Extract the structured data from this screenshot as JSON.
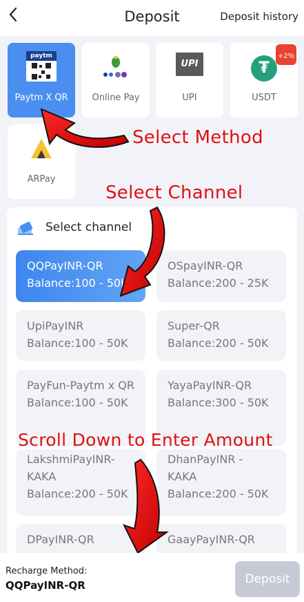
{
  "header": {
    "back_icon": "chevron-left-icon",
    "title": "Deposit",
    "history_link": "Deposit history"
  },
  "methods": [
    {
      "label": "Paytm X QR",
      "logo_text": "paytm",
      "active": true
    },
    {
      "label": "Online Pay",
      "active": false
    },
    {
      "label": "UPI",
      "logo_text": "UPI",
      "active": false
    },
    {
      "label": "USDT",
      "badge": "+2%",
      "active": false
    },
    {
      "label": "ARPay",
      "active": false
    }
  ],
  "channel_section": {
    "title": "Select channel"
  },
  "channels": [
    {
      "name": "QQPayINR-QR",
      "balance": "Balance:100 - 50K",
      "active": true
    },
    {
      "name": "OSpayINR-QR",
      "balance": "Balance:200 - 25K",
      "active": false
    },
    {
      "name": "UpiPayINR",
      "balance": "Balance:100 - 50K",
      "active": false
    },
    {
      "name": "Super-QR",
      "balance": "Balance:200 - 50K",
      "active": false
    },
    {
      "name": "PayFun-Paytm x QR",
      "balance": "Balance:100 - 50K",
      "active": false
    },
    {
      "name": "YayaPayINR-QR",
      "balance": "Balance:300 - 50K",
      "active": false
    },
    {
      "name": "LakshmiPayINR-KAKA",
      "balance": "Balance:200 - 50K",
      "active": false
    },
    {
      "name": "DhanPayINR - KAKA",
      "balance": "Balance:200 - 50K",
      "active": false
    },
    {
      "name": "DPayINR-QR",
      "active": false
    },
    {
      "name": "GaayPayINR-QR",
      "active": false
    }
  ],
  "annotations": {
    "select_method": "Select Method",
    "select_channel": "Select Channel",
    "scroll_down": "Scroll Down to Enter Amount"
  },
  "bottom": {
    "recharge_method_label": "Recharge Method:",
    "recharge_method_value": "QQPayINR-QR",
    "deposit_button": "Deposit"
  },
  "colors": {
    "accent": "#4a8ff0",
    "annotation_red": "#e01010",
    "disabled_button": "#c7cad6"
  }
}
